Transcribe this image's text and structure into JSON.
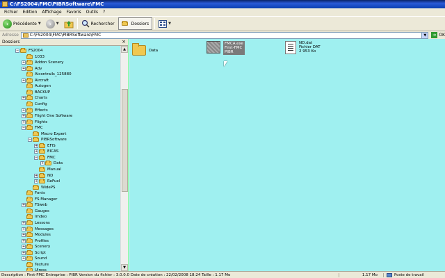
{
  "window": {
    "title": "C:\\FS2004\\FMC\\PIBRSoftware\\FMC"
  },
  "menu": [
    "Fichier",
    "Edition",
    "Affichage",
    "Favoris",
    "Outils",
    "?"
  ],
  "toolbar": {
    "back_label": "Précédente",
    "search_label": "Rechercher",
    "folders_label": "Dossiers"
  },
  "address": {
    "label": "Adresse",
    "value": "C:\\FS2004\\FMC\\PIBRSoftware\\FMC",
    "go_label": "OK"
  },
  "folders_pane": {
    "title": "Dossiers"
  },
  "tree": [
    {
      "label": "FS2004",
      "pm": "-",
      "level": 0
    },
    {
      "label": "1033",
      "pm": "",
      "level": 1
    },
    {
      "label": "Addon Scenery",
      "pm": "+",
      "level": 1
    },
    {
      "label": "Adv",
      "pm": "+",
      "level": 1
    },
    {
      "label": "Aicontrails_125880",
      "pm": "",
      "level": 1
    },
    {
      "label": "Aircraft",
      "pm": "+",
      "level": 1
    },
    {
      "label": "Autogen",
      "pm": "",
      "level": 1
    },
    {
      "label": "BACKUP",
      "pm": "",
      "level": 1
    },
    {
      "label": "Charts",
      "pm": "+",
      "level": 1
    },
    {
      "label": "Config",
      "pm": "",
      "level": 1
    },
    {
      "label": "Effects",
      "pm": "+",
      "level": 1
    },
    {
      "label": "Flight One Software",
      "pm": "+",
      "level": 1
    },
    {
      "label": "Flights",
      "pm": "+",
      "level": 1
    },
    {
      "label": "FMC",
      "pm": "-",
      "level": 1
    },
    {
      "label": "Macro Expert",
      "pm": "",
      "level": 2
    },
    {
      "label": "PIBRSoftware",
      "pm": "-",
      "level": 2
    },
    {
      "label": "EFIS",
      "pm": "+",
      "level": 3
    },
    {
      "label": "EICAS",
      "pm": "+",
      "level": 3
    },
    {
      "label": "FMC",
      "pm": "-",
      "level": 3
    },
    {
      "label": "Data",
      "pm": "+",
      "level": 4
    },
    {
      "label": "Manual",
      "pm": "",
      "level": 3
    },
    {
      "label": "ND",
      "pm": "+",
      "level": 3
    },
    {
      "label": "ReFuel",
      "pm": "+",
      "level": 3
    },
    {
      "label": "WidePS",
      "pm": "",
      "level": 2
    },
    {
      "label": "Fonts",
      "pm": "",
      "level": 1
    },
    {
      "label": "FS Manager",
      "pm": "",
      "level": 1
    },
    {
      "label": "FSweb",
      "pm": "+",
      "level": 1
    },
    {
      "label": "Gauges",
      "pm": "",
      "level": 1
    },
    {
      "label": "Imdeo",
      "pm": "",
      "level": 1
    },
    {
      "label": "Lessons",
      "pm": "+",
      "level": 1
    },
    {
      "label": "Messages",
      "pm": "+",
      "level": 1
    },
    {
      "label": "Modules",
      "pm": "+",
      "level": 1
    },
    {
      "label": "Profiles",
      "pm": "+",
      "level": 1
    },
    {
      "label": "Scenery",
      "pm": "+",
      "level": 1
    },
    {
      "label": "Script",
      "pm": "+",
      "level": 1
    },
    {
      "label": "Sound",
      "pm": "+",
      "level": 1
    },
    {
      "label": "Texture",
      "pm": "",
      "level": 1
    },
    {
      "label": "Uiress",
      "pm": "",
      "level": 1
    }
  ],
  "files": {
    "data_folder": {
      "name": "Data"
    },
    "exe": {
      "name": "FMCA.exe",
      "desc": "First-FMC",
      "company": "PIBR"
    },
    "dat": {
      "name": "ND.dat",
      "type": "Fichier DAT",
      "size": "2 953 Ko"
    }
  },
  "status": {
    "description": "Description : First-FMC Entreprise : PIBR Version du fichier : 3.0.0.0 Date de création : 22/02/2008 18:24 Taille : 1.17 Mo",
    "size": "1.17 Mo",
    "location": "Poste de travail"
  }
}
